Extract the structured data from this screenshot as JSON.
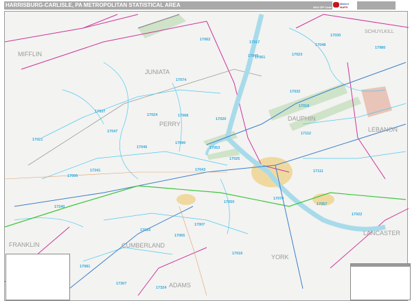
{
  "header": {
    "title": "HARRISBURG-CARLISLE, PA METROPOLITAN STATISTICAL AREA",
    "edition": "2024 ZIP Code Premium Edition"
  },
  "logo": {
    "line1": "Market",
    "line2": "MAPS"
  },
  "colors": {
    "header": "#a9a9a9",
    "water": "#a8dbea",
    "zip_boundary": "#4ec9f0",
    "county_boundary": "#cc3399",
    "highway": "#3a7fc9",
    "turnpike": "#3cc43c",
    "urban": "#f0d9a0",
    "forest": "#cfe3c9"
  },
  "counties": [
    {
      "name": "JUNIATA"
    },
    {
      "name": "MIFFLIN"
    },
    {
      "name": "SCHUYLKILL"
    },
    {
      "name": "DAUPHIN"
    },
    {
      "name": "PERRY"
    },
    {
      "name": "LEBANON"
    },
    {
      "name": "FRANKLIN"
    },
    {
      "name": "CUMBERLAND"
    },
    {
      "name": "LANCASTER"
    },
    {
      "name": "YORK"
    },
    {
      "name": "ADAMS"
    }
  ],
  "zips": [
    "17017",
    "17030",
    "17048",
    "17980",
    "17062",
    "17045",
    "17023",
    "17061",
    "17032",
    "17074",
    "17024",
    "17068",
    "17020",
    "17018",
    "17037",
    "17047",
    "17021",
    "17046",
    "17090",
    "17053",
    "17112",
    "17006",
    "17241",
    "17240",
    "17015",
    "17007",
    "17050",
    "17016",
    "17022",
    "17057",
    "17081",
    "17324",
    "17307",
    "17065",
    "17025",
    "17043",
    "17111",
    "17070"
  ]
}
